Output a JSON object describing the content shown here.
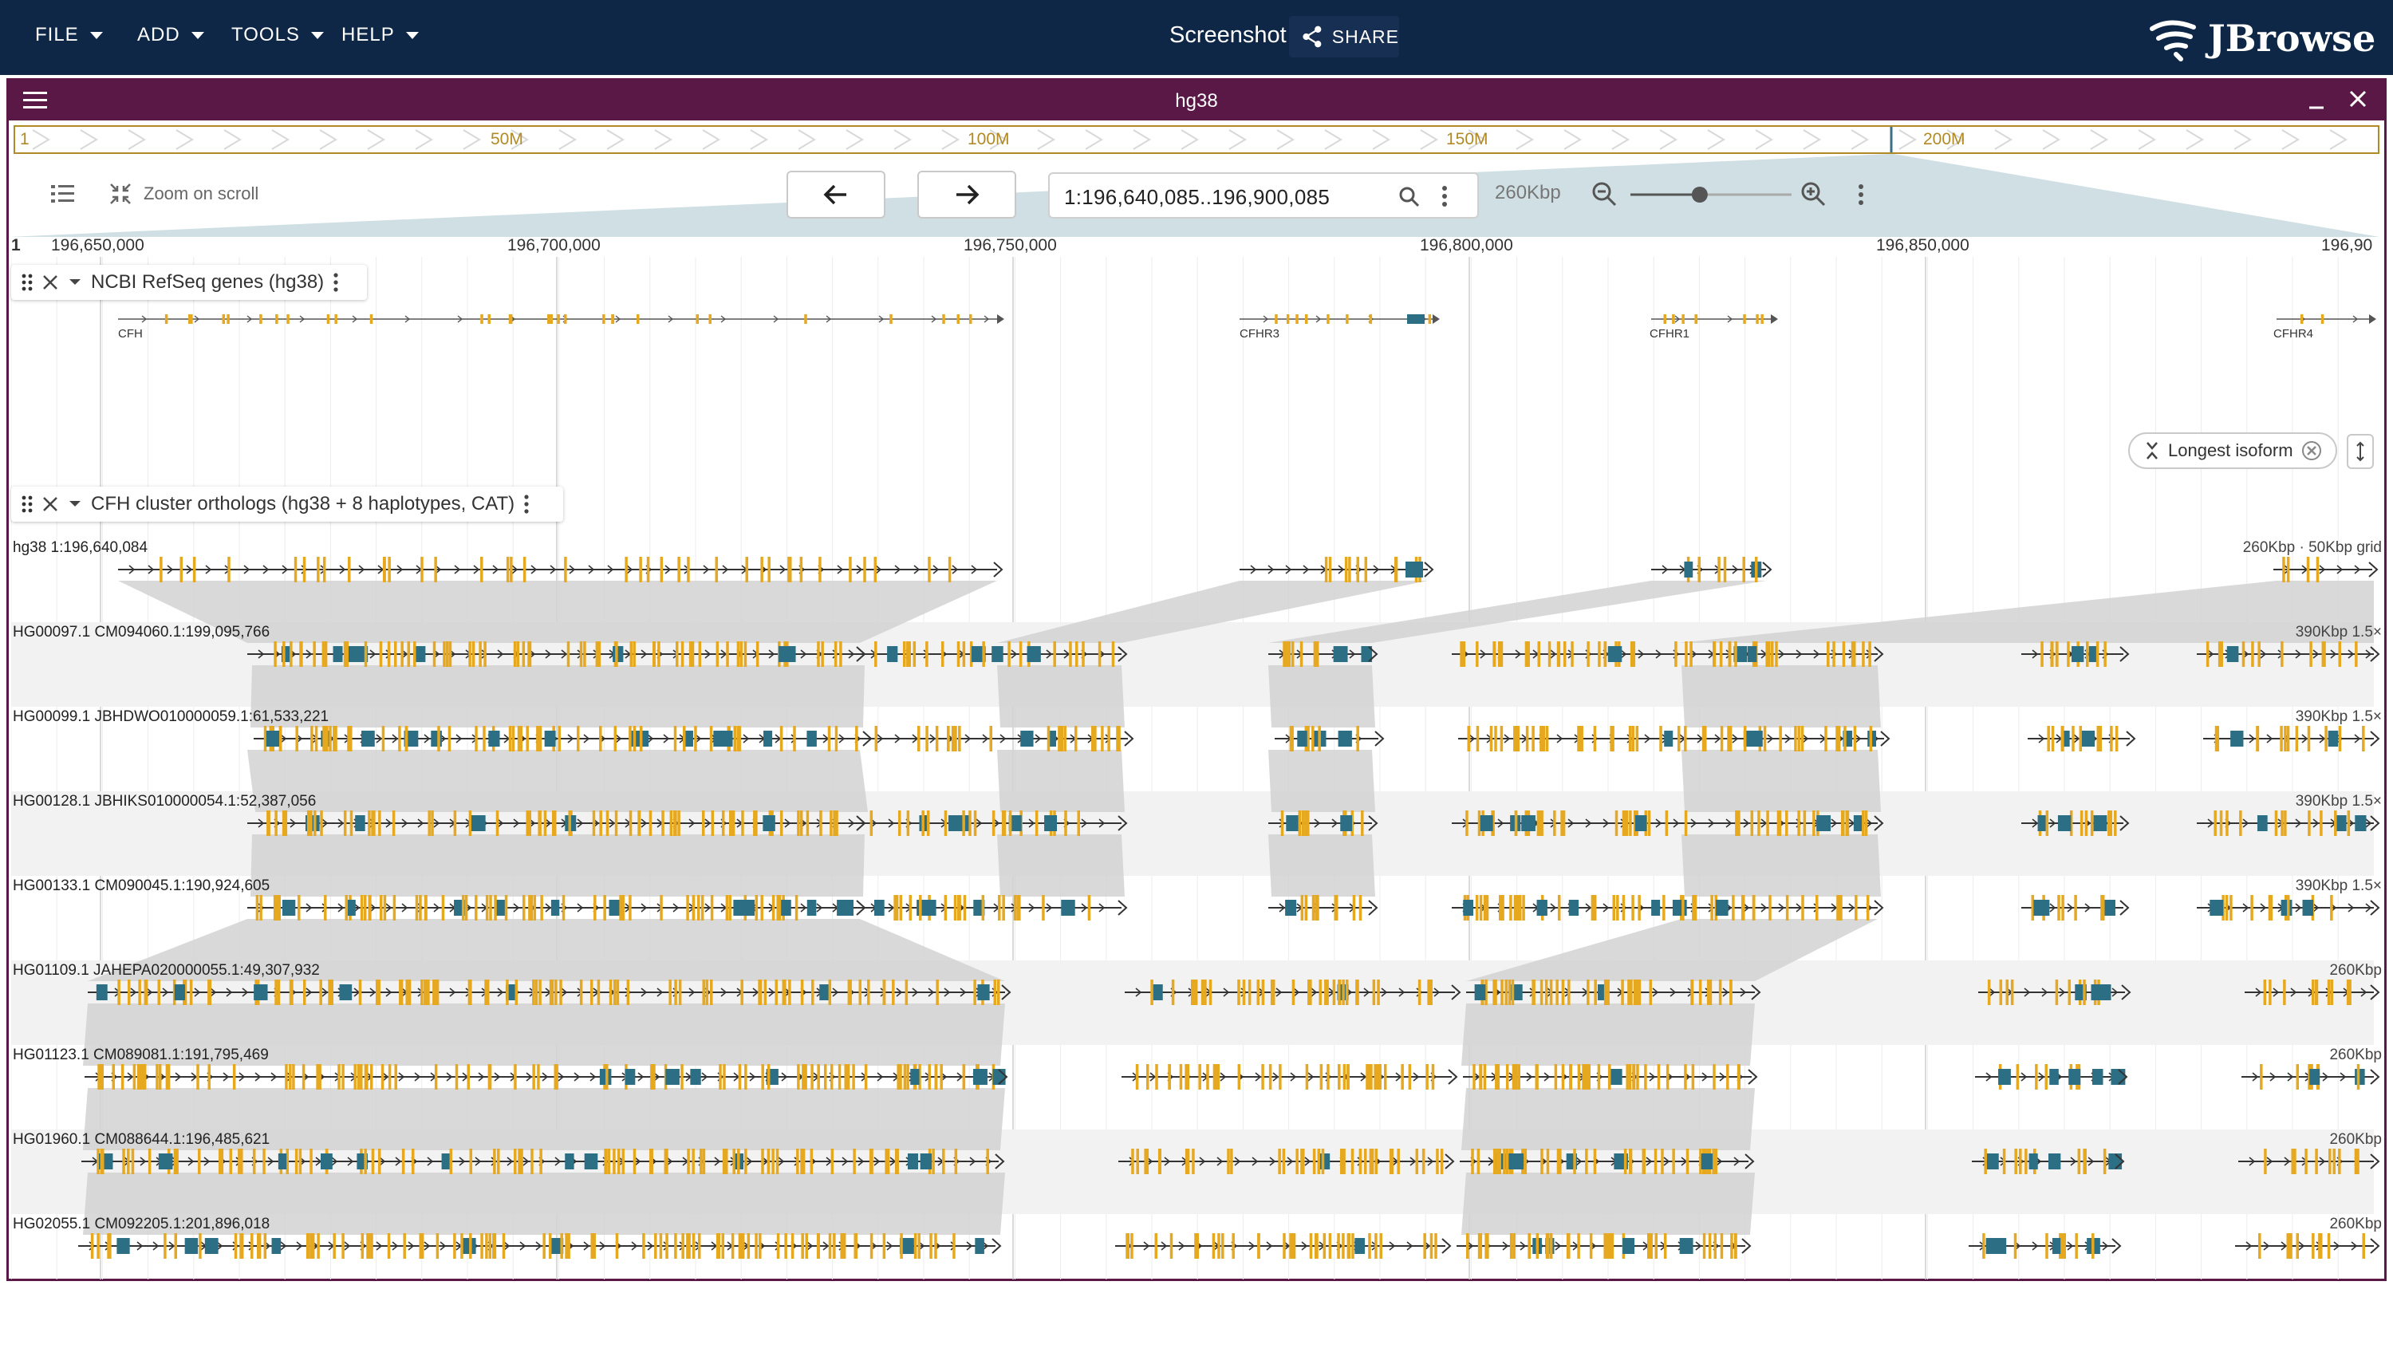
{
  "appbar": {
    "menus": [
      "FILE",
      "ADD",
      "TOOLS",
      "HELP"
    ],
    "session_title": "Screenshot",
    "share_label": "SHARE",
    "logo_text": "JBrowse",
    "bg_color": "#0e2747"
  },
  "view": {
    "title": "hg38",
    "header_color": "#5a1846",
    "overview_labels": [
      "1",
      "50M",
      "100M",
      "150M",
      "200M"
    ],
    "zoom_on_scroll": "Zoom on scroll",
    "location": "1:196,640,085..196,900,085",
    "bp_per_view": "260Kbp",
    "zoom_level_fraction": 0.43,
    "ruler_start_label": "1",
    "ruler_ticks": [
      "196,650,000",
      "196,700,000",
      "196,750,000",
      "196,800,000",
      "196,850,000",
      "196,90"
    ]
  },
  "tracks": {
    "refseq": {
      "name": "NCBI RefSeq genes (hg38)",
      "genes": [
        "CFH",
        "CFHR3",
        "CFHR1",
        "CFHR4"
      ]
    },
    "orthologs": {
      "name": "CFH cluster orthologs (hg38 + 8 haplotypes, CAT)",
      "isoform_chip": "Longest isoform",
      "rows": [
        {
          "label": "hg38 1:196,640,084",
          "right": "260Kbp · 50Kbp grid"
        },
        {
          "label": "HG00097.1 CM094060.1:199,095,766",
          "right": "390Kbp 1.5×"
        },
        {
          "label": "HG00099.1 JBHDWO010000059.1:61,533,221",
          "right": "390Kbp 1.5×"
        },
        {
          "label": "HG00128.1 JBHIKS010000054.1:52,387,056",
          "right": "390Kbp 1.5×"
        },
        {
          "label": "HG00133.1 CM090045.1:190,924,605",
          "right": "390Kbp 1.5×"
        },
        {
          "label": "HG01109.1 JAHEPA020000055.1:49,307,932",
          "right": "260Kbp"
        },
        {
          "label": "HG01123.1 CM089081.1:191,795,469",
          "right": "260Kbp"
        },
        {
          "label": "HG01960.1 CM088644.1:196,485,621",
          "right": "260Kbp"
        },
        {
          "label": "HG02055.1 CM092205.1:201,896,018",
          "right": "260Kbp"
        }
      ]
    }
  },
  "colors": {
    "exon_utr": "#e6a81f",
    "exon_cds": "#2c6e84",
    "synteny": "#d2d2d2",
    "overview_border": "#b08a24"
  }
}
